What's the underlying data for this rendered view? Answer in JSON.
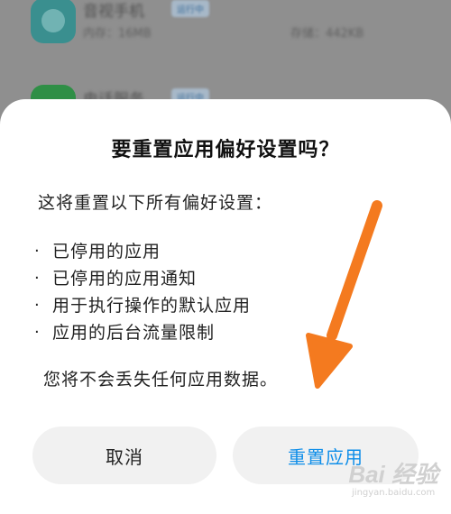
{
  "background": {
    "apps": [
      {
        "name": "音视手机",
        "tag": "运行中",
        "meta_left": "内存：16MB",
        "meta_right": "存储：442KB",
        "icon": "app-icon-teal"
      },
      {
        "name": "电话服务",
        "tag": "运行中",
        "icon": "app-icon-green"
      }
    ]
  },
  "dialog": {
    "title": "要重置应用偏好设置吗？",
    "intro": "这将重置以下所有偏好设置：",
    "bullets": [
      {
        "dot": "·",
        "text": "已停用的应用"
      },
      {
        "dot": "·",
        "text": "已停用的应用通知"
      },
      {
        "dot": "·",
        "text": "用于执行操作的默认应用"
      },
      {
        "dot": "·",
        "text": "应用的后台流量限制"
      }
    ],
    "note": "您将不会丢失任何应用数据。",
    "cancel_label": "取消",
    "reset_label": "重置应用"
  },
  "annotation": {
    "arrow_color": "#f47a1f",
    "arrow_icon": "arrow-down-left-icon"
  },
  "watermark": {
    "logo": "Bai 经验",
    "url": "jingyan.baidu.com"
  },
  "colors": {
    "accent": "#0f8ee9",
    "dialog_bg": "#ffffff",
    "button_bg": "#f1f1f1",
    "scrim": "#8f8f8f"
  }
}
